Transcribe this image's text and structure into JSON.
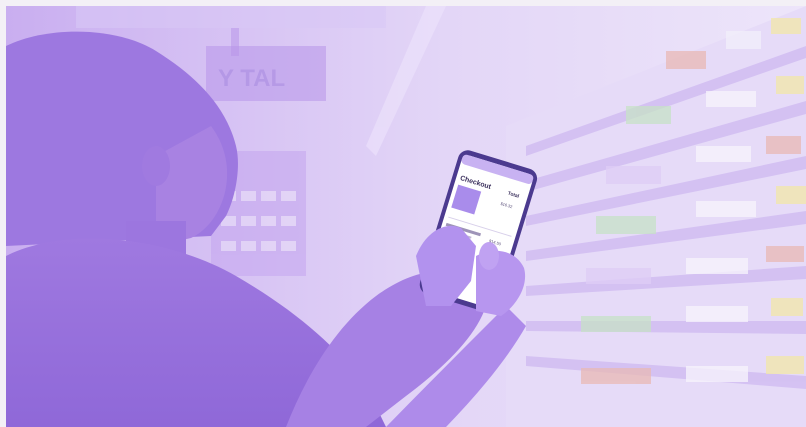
{
  "illustration": {
    "sign_text": "Y TAL",
    "phone": {
      "screen_title": "Checkout",
      "screen_total_label": "Total",
      "price_primary": "$16.32",
      "price_secondary": "$14.50"
    }
  }
}
